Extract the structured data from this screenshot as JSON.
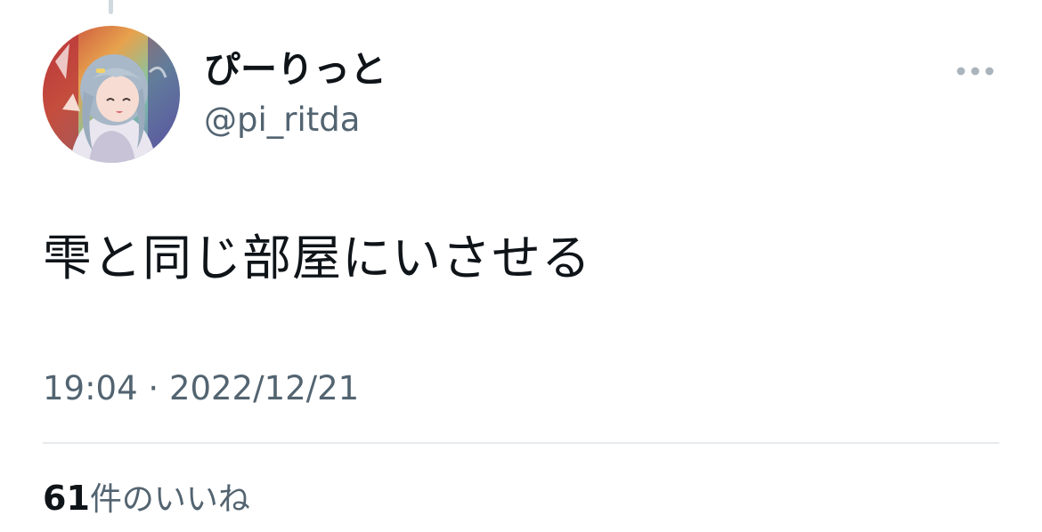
{
  "tweet": {
    "author": {
      "display_name": "ぴーりっと",
      "handle": "@pi_ritda"
    },
    "text": "雫と同じ部屋にいさせる",
    "time": "19:04",
    "separator": "·",
    "date": "2022/12/21",
    "likes": {
      "count": "61",
      "label": "件のいいね"
    }
  },
  "icons": {
    "more": "more-horizontal-icon"
  },
  "colors": {
    "text_primary": "#0f1419",
    "text_secondary": "#536471",
    "divider": "#e7ebee",
    "icon_gray": "#aab4bd"
  }
}
